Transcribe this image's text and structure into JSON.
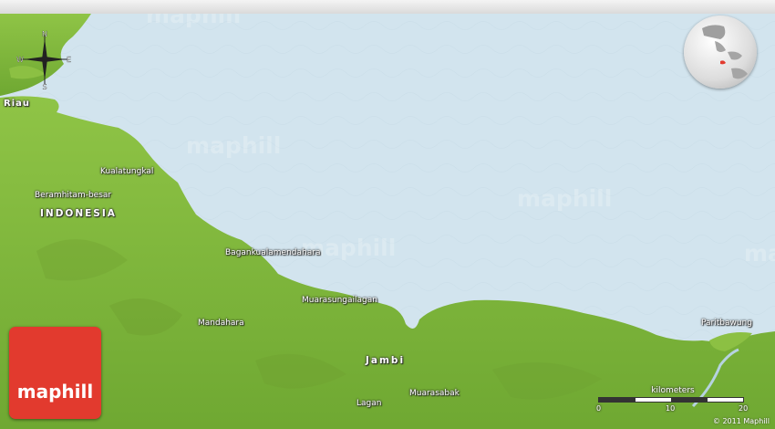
{
  "map": {
    "country": "INDONESIA",
    "region": "Riau",
    "province": "Jambi",
    "places": [
      "Kualatungkal",
      "Beramhitam-besar",
      "Bagankualamendahara",
      "Muarasungailagan",
      "Mandahara",
      "Lagan",
      "Muarasabak",
      "Paritbawung"
    ],
    "watermark": "maphill"
  },
  "compass": {
    "n": "N",
    "s": "S",
    "e": "E",
    "w": "W"
  },
  "scale": {
    "title": "kilometers",
    "ticks": [
      "0",
      "10",
      "20"
    ]
  },
  "logo": {
    "text": "maphill"
  },
  "copyright": "© 2011 Maphill",
  "colors": {
    "sea": "#d2e4ee",
    "land": "#86bd3f",
    "logo": "#e23a2e"
  }
}
